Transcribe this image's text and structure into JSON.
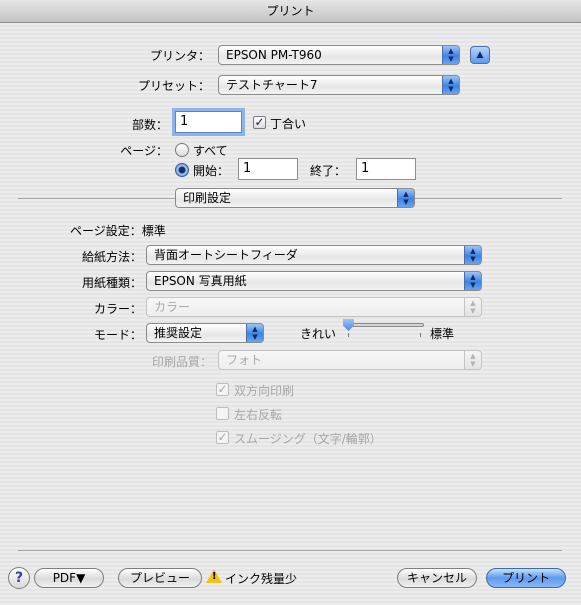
{
  "window": {
    "title": "プリント"
  },
  "printer": {
    "label": "プリンタ：",
    "value": "EPSON PM-T960"
  },
  "preset": {
    "label": "プリセット：",
    "value": "テストチャート7"
  },
  "copies": {
    "label": "部数：",
    "value": "1",
    "collate_label": "丁合い",
    "collate_checked": true
  },
  "pages": {
    "label": "ページ：",
    "all_label": "すべて",
    "from_label": "開始：",
    "from_value": "1",
    "to_label": "終了：",
    "to_value": "1"
  },
  "panel_menu": {
    "value": "印刷設定"
  },
  "page_setup": {
    "text": "ページ設定：標準"
  },
  "paper_feed": {
    "label": "給紙方法：",
    "value": "背面オートシートフィーダ"
  },
  "media_type": {
    "label": "用紙種類：",
    "value": "EPSON 写真用紙"
  },
  "color": {
    "label": "カラー：",
    "value": "カラー"
  },
  "mode": {
    "label": "モード：",
    "value": "推奨設定",
    "slider_left": "きれい",
    "slider_right": "標準",
    "slider_level": 0
  },
  "quality": {
    "label": "印刷品質：",
    "value": "フォト"
  },
  "options": [
    {
      "label": "双方向印刷",
      "checked": true
    },
    {
      "label": "左右反転",
      "checked": false
    },
    {
      "label": "スムージング（文字/輪郭）",
      "checked": true
    }
  ],
  "footer": {
    "help": "?",
    "pdf": "PDF▼",
    "preview": "プレビュー",
    "ink_warning": "インク残量少",
    "cancel": "キャンセル",
    "print": "プリント"
  },
  "icons": {
    "popup_arrows": "updown-arrows-icon",
    "disclosure": "triangle-up-icon",
    "warning": "warning-triangle-icon"
  }
}
